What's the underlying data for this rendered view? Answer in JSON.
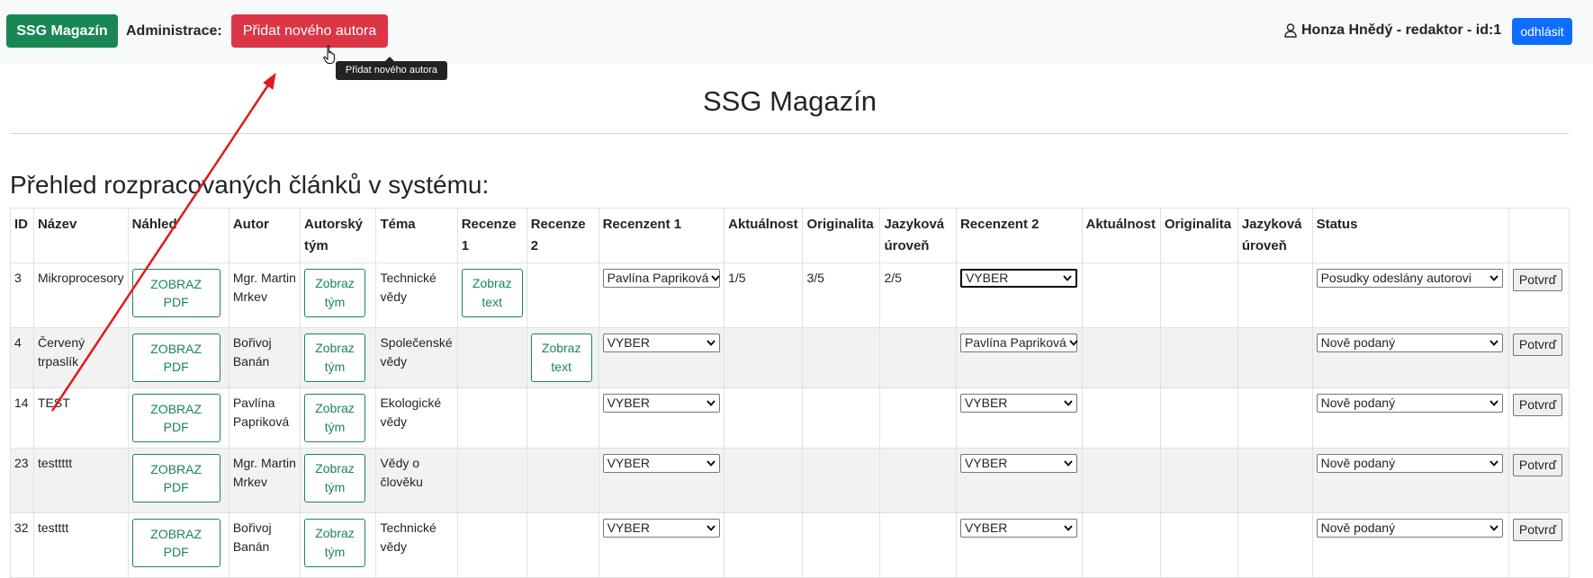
{
  "navbar": {
    "brand": "SSG Magazín",
    "admin_label": "Administrace:",
    "add_author_button": "Přidat nového autora",
    "user_info": "Honza Hnědý - redaktor - id:1",
    "logout_button": "odhlásit"
  },
  "tooltip": "Přidat nového autora",
  "page_title": "SSG Magazín",
  "section_title": "Přehled rozpracovaných článků v systému:",
  "table": {
    "headers": {
      "id": "ID",
      "nazev": "Název",
      "nahled": "Náhled",
      "autor": "Autor",
      "autorsky_tym": "Autorský tým",
      "tema": "Téma",
      "recenze1": "Recenze 1",
      "recenze2": "Recenze 2",
      "recenzent1": "Recenzent 1",
      "aktualnost1": "Aktuálnost",
      "originalita1": "Originalita",
      "jazykova1": "Jazyková úroveň",
      "recenzent2": "Recenzent 2",
      "aktualnost2": "Aktuálnost",
      "originalita2": "Originalita",
      "jazykova2": "Jazyková úroveň",
      "status": "Status"
    },
    "labels": {
      "pdf_button": "ZOBRAZ PDF",
      "team_button": "Zobraz tým",
      "text_button": "Zobraz text",
      "confirm_button": "Potvrď"
    },
    "rows": [
      {
        "id": "3",
        "nazev": "Mikroprocesory",
        "autor": "Mgr. Martin Mrkev",
        "tema": "Technické vědy",
        "recenzent1": "Pavlína Papriková",
        "akt1": "1/5",
        "orig1": "3/5",
        "jaz1": "2/5",
        "recenzent2": "VYBER",
        "status": "Posudky odeslány autorovi"
      },
      {
        "id": "4",
        "nazev": "Červený trpaslík",
        "autor": "Bořivoj Banán",
        "tema": "Společenské vědy",
        "recenzent1": "VYBER",
        "akt1": "",
        "orig1": "",
        "jaz1": "",
        "recenzent2": "Pavlína Papriková",
        "status": "Nově podaný"
      },
      {
        "id": "14",
        "nazev": "TEST",
        "autor": "Pavlína Papriková",
        "tema": "Ekologické vědy",
        "recenzent1": "VYBER",
        "akt1": "",
        "orig1": "",
        "jaz1": "",
        "recenzent2": "VYBER",
        "status": "Nově podaný"
      },
      {
        "id": "23",
        "nazev": "testtttt",
        "autor": "Mgr. Martin Mrkev",
        "tema": "Vědy o člověku",
        "recenzent1": "VYBER",
        "akt1": "",
        "orig1": "",
        "jaz1": "",
        "recenzent2": "VYBER",
        "status": "Nově podaný"
      },
      {
        "id": "32",
        "nazev": "testttt",
        "autor": "Bořivoj Banán",
        "tema": "Technické vědy",
        "recenzent1": "VYBER",
        "akt1": "",
        "orig1": "",
        "jaz1": "",
        "recenzent2": "VYBER",
        "status": "Nově podaný"
      }
    ]
  },
  "colors": {
    "brand_green": "#198754",
    "danger_red": "#dc3545",
    "primary_blue": "#0d6efd",
    "annotation_arrow": "#e0191b"
  },
  "icons": {
    "user": "user-outline-icon",
    "cursor": "hand-pointer-icon",
    "chevron": "chevron-down-icon"
  }
}
